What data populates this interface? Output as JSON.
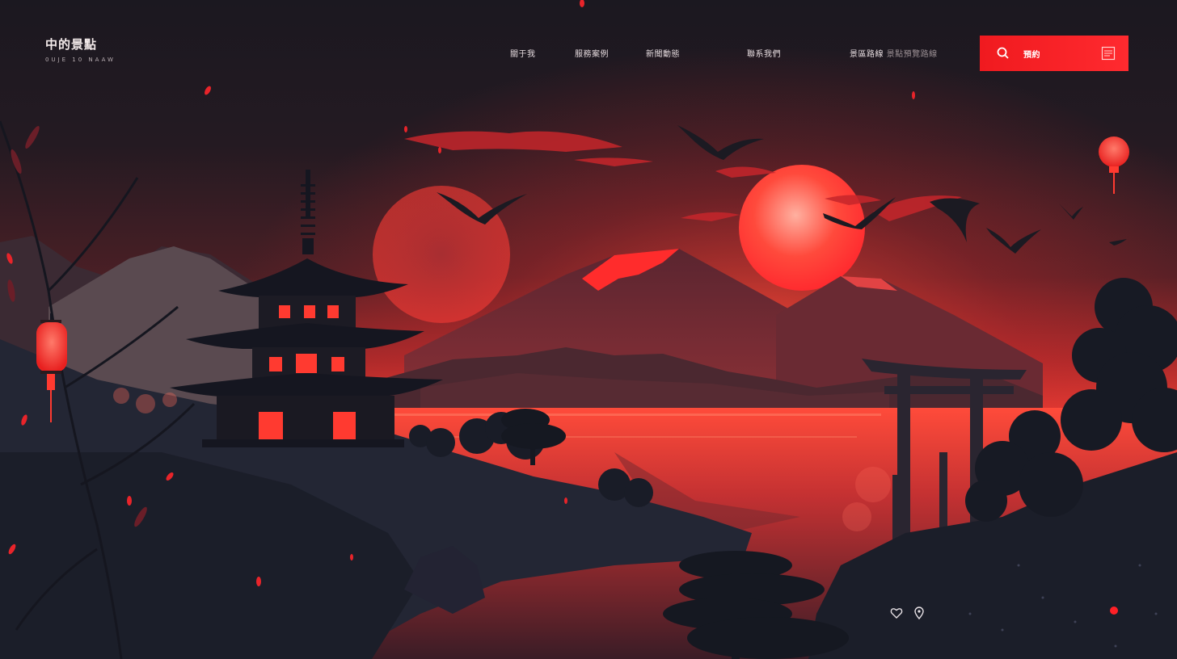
{
  "brand": {
    "name": "中的景點",
    "subtitle": "0UJE 10 NAAW"
  },
  "nav": {
    "items": [
      {
        "label": "關于我"
      },
      {
        "label": "服務案例"
      },
      {
        "label": "新聞動態"
      },
      {
        "label": "聯系我們"
      },
      {
        "label": "景區路線",
        "suffix": "景點預覽路線"
      }
    ]
  },
  "search": {
    "label": "預約"
  },
  "icons": {
    "search": "search-icon",
    "menu": "grid-icon",
    "heart": "heart-icon",
    "location": "location-pin-icon"
  },
  "colors": {
    "accent": "#ff1e24",
    "sky_top": "#1b1820",
    "sky_bottom": "#ff3a2f",
    "mountain": "#3a1a22",
    "silhouette": "#171b26"
  }
}
